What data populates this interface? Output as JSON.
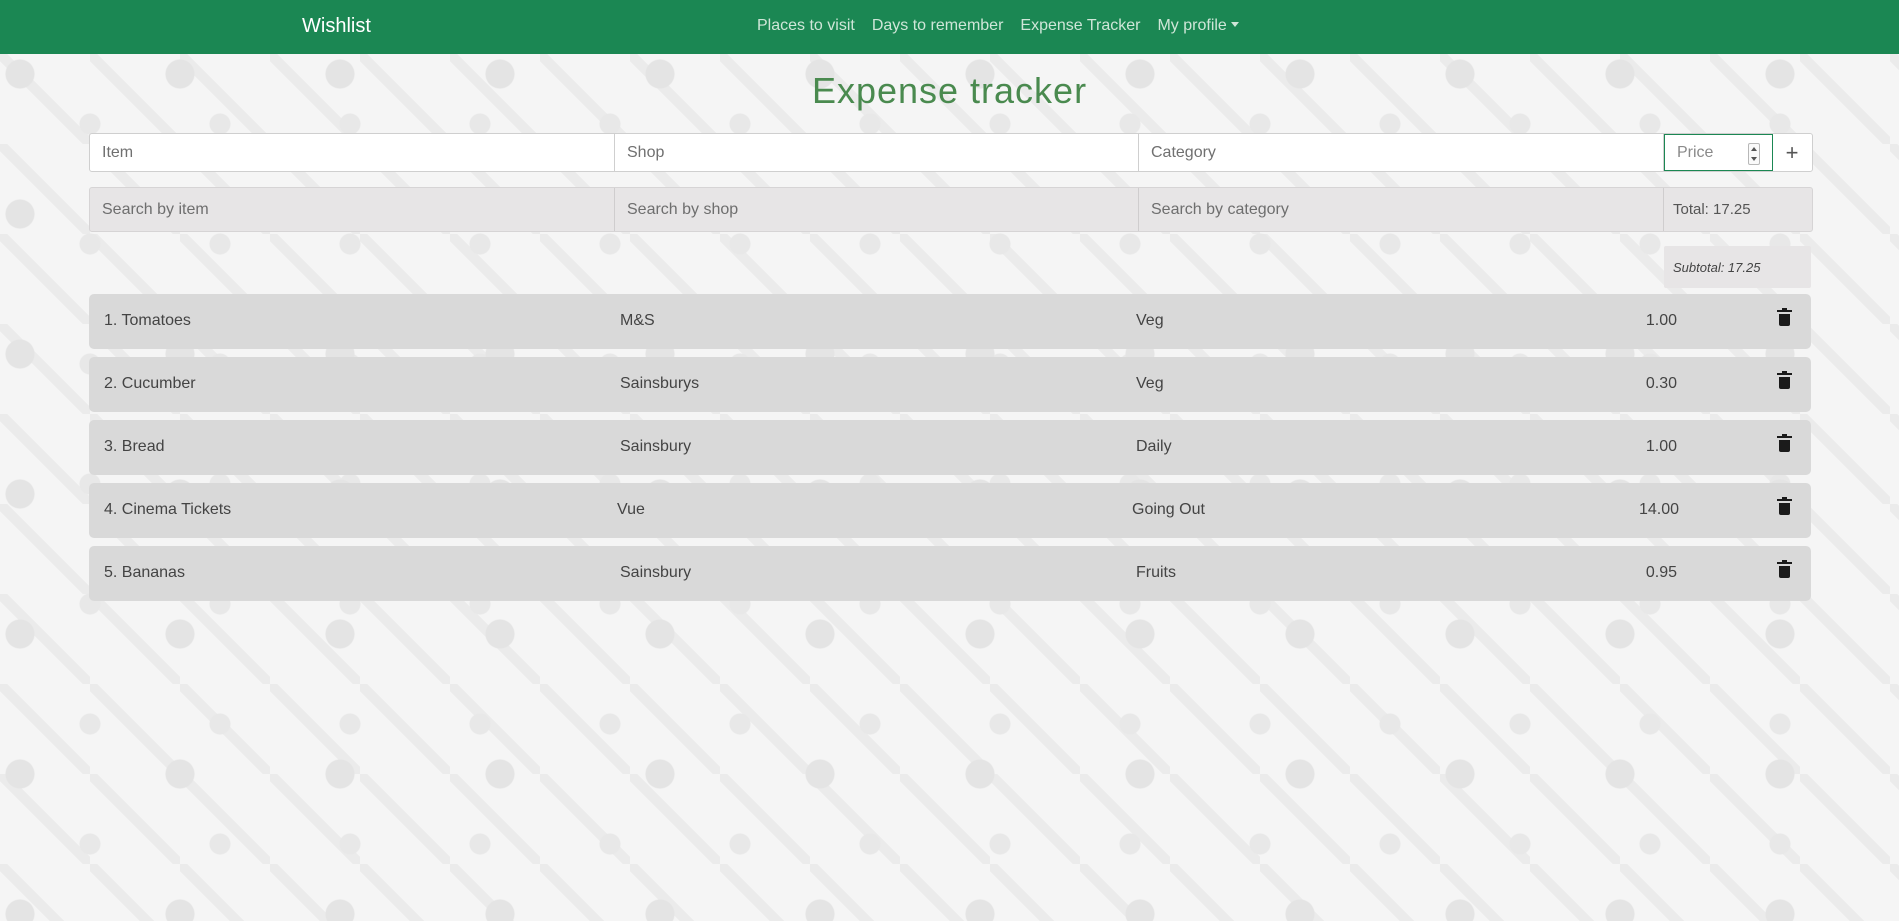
{
  "nav": {
    "brand": "Wishlist",
    "links": [
      "Places to visit",
      "Days to remember",
      "Expense Tracker",
      "My profile"
    ]
  },
  "page": {
    "title": "Expense tracker"
  },
  "form": {
    "item_placeholder": "Item",
    "shop_placeholder": "Shop",
    "category_placeholder": "Category",
    "price_placeholder": "Price",
    "add_label": "+"
  },
  "search": {
    "item_placeholder": "Search by item",
    "shop_placeholder": "Search by shop",
    "category_placeholder": "Search by category",
    "total": "Total: 17.25"
  },
  "subtotal": "Subtotal: 17.25",
  "expenses": [
    {
      "item": "1. Tomatoes",
      "shop": "M&S",
      "category": "Veg",
      "price": "1.00"
    },
    {
      "item": "2. Cucumber",
      "shop": "Sainsburys",
      "category": "Veg",
      "price": "0.30"
    },
    {
      "item": "3. Bread",
      "shop": "Sainsbury",
      "category": "Daily",
      "price": "1.00"
    },
    {
      "item": "4. Cinema Tickets",
      "shop": "Vue",
      "category": "Going Out",
      "price": "14.00"
    },
    {
      "item": "5. Bananas",
      "shop": "Sainsbury",
      "category": "Fruits",
      "price": "0.95"
    }
  ],
  "colors": {
    "navbar": "#1b8753",
    "title": "#4a8a4f",
    "row": "#d9d9d9"
  },
  "icons": {
    "delete": "trash-icon",
    "add": "plus-icon",
    "dropdown": "caret-down-icon"
  }
}
